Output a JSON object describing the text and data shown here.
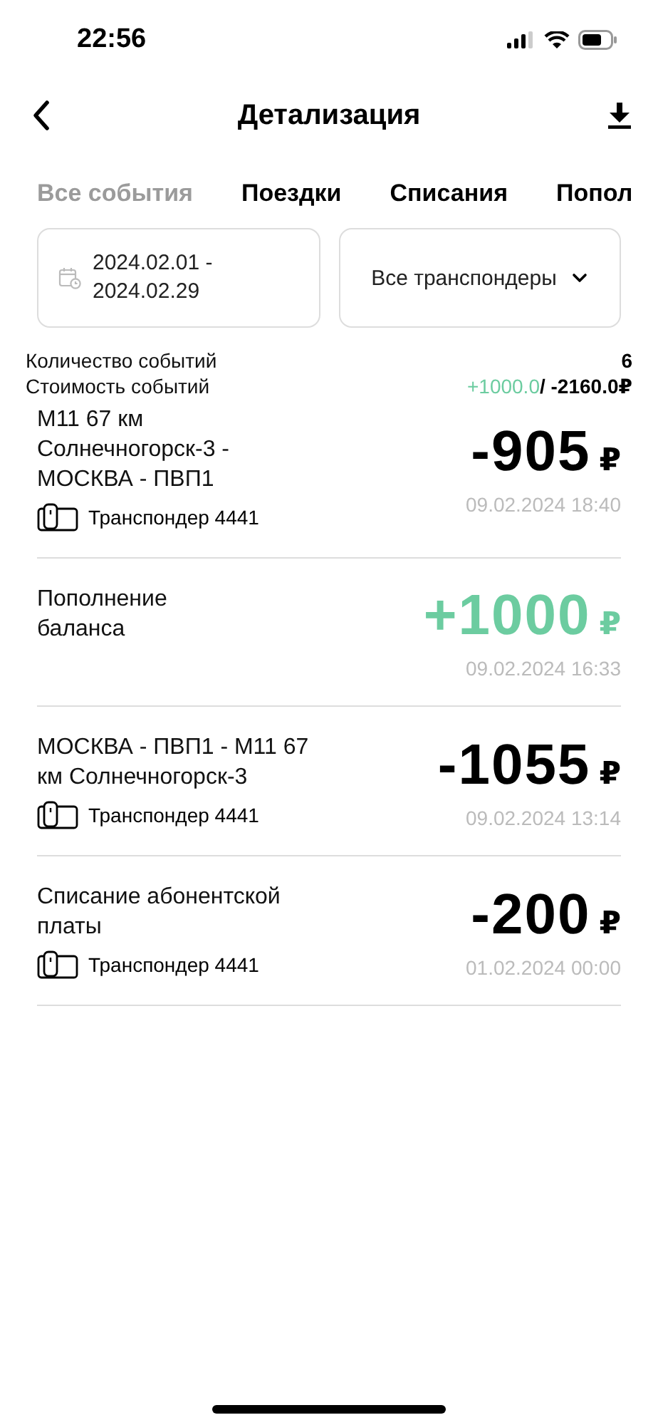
{
  "status_bar": {
    "time": "22:56"
  },
  "header": {
    "title": "Детализация"
  },
  "tabs": [
    {
      "label": "Все события",
      "selected": true
    },
    {
      "label": "Поездки",
      "selected": false
    },
    {
      "label": "Списания",
      "selected": false
    },
    {
      "label": "Попол",
      "selected": false
    }
  ],
  "filters": {
    "period": "2024.02.01 -\n2024.02.29",
    "transponder": "Все транспондеры"
  },
  "summary": {
    "count_label": "Количество событий",
    "count": "6",
    "cost_label": "Стоимость событий",
    "income": "+1000.0",
    "expense": " / -2160.0₽"
  },
  "events": [
    {
      "title": "М11 67 км\nСолнечногорск-3 -\nМОСКВА - ПВП1",
      "kind": "debit",
      "amount": "-905",
      "currency": "₽",
      "transponder": "Транспондер 4441",
      "datetime": "09.02.2024 18:40"
    },
    {
      "title": "Пополнение\nбаланса",
      "kind": "credit",
      "amount": "+1000",
      "currency": "₽",
      "datetime": "09.02.2024 16:33"
    },
    {
      "title": "МОСКВА - ПВП1 - М11 67\nкм Солнечногорск-3",
      "kind": "debit",
      "amount": "-1055",
      "currency": "₽",
      "transponder": "Транспондер 4441",
      "datetime": "09.02.2024 13:14"
    },
    {
      "title": "Списание абонентской\nплаты",
      "kind": "debit",
      "amount": "-200",
      "currency": "₽",
      "transponder": "Транспондер 4441",
      "datetime": "01.02.2024 00:00"
    }
  ]
}
